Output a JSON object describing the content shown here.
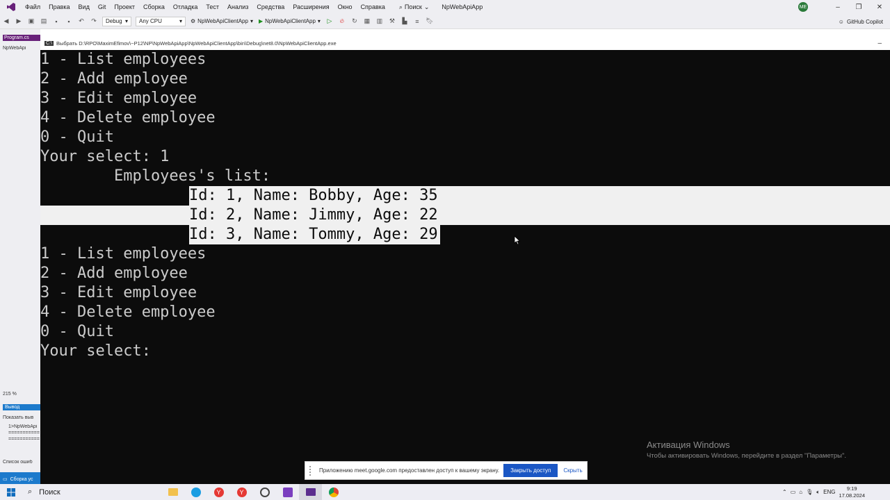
{
  "vs": {
    "menu": [
      "Файл",
      "Правка",
      "Вид",
      "Git",
      "Проект",
      "Сборка",
      "Отладка",
      "Тест",
      "Анализ",
      "Средства",
      "Расширения",
      "Окно",
      "Справка"
    ],
    "search_label": "Поиск",
    "solution_title": "NpWebApiApp",
    "avatar_initials": "ME",
    "toolbar": {
      "config": "Debug",
      "platform": "Any CPU",
      "startup_project": "NpWebApiClientApp",
      "run_label": "NpWebApiClientApp",
      "copilot_label": "GitHub Copilot"
    },
    "left": {
      "doc_tab": "Program.cs",
      "explorer_tab": "NpWebApi",
      "zoom": "215 %",
      "output_tab": "Вывод",
      "output_show": "Показать выв",
      "output_line1": "1>NpWebApi",
      "output_line2": "===========",
      "output_line3": "===========",
      "errors_tab": "Список ошиб",
      "status": "Сборка ус"
    }
  },
  "console": {
    "title": "Выбрать D:\\RPO\\MaximEfimov\\~P12\\NP\\NpWebApiApp\\NpWebApiClientApp\\bin\\Debug\\net8.0\\NpWebApiClientApp.exe",
    "menu1": [
      "1 - List employees",
      "2 - Add employee",
      "3 - Edit employee",
      "4 - Delete employee",
      "0 - Quit"
    ],
    "prompt1": "Your select: 1",
    "list_header": "        Employees's list:",
    "employees": [
      "Id: 1, Name: Bobby, Age: 35",
      "Id: 2, Name: Jimmy, Age: 22",
      "Id: 3, Name: Tommy, Age: 29"
    ],
    "menu2": [
      "1 - List employees",
      "2 - Add employee",
      "3 - Edit employee",
      "4 - Delete employee",
      "0 - Quit"
    ],
    "prompt2": "Your select:"
  },
  "activation": {
    "title": "Активация Windows",
    "subtitle": "Чтобы активировать Windows, перейдите в раздел \"Параметры\"."
  },
  "share_bar": {
    "message": "Приложению meet.google.com предоставлен доступ к вашему экрану.",
    "stop_label": "Закрыть доступ",
    "hide_label": "Скрыть"
  },
  "taskbar": {
    "search_label": "Поиск",
    "lang": "ENG",
    "time": "9:19",
    "date": "17.08.2024"
  },
  "colors": {
    "console_bg": "#0c0c0c",
    "console_fg": "#cccccc",
    "selection_bg": "#f0f0f0",
    "share_button": "#1a56c4",
    "vs_chrome": "#eeeef2"
  }
}
